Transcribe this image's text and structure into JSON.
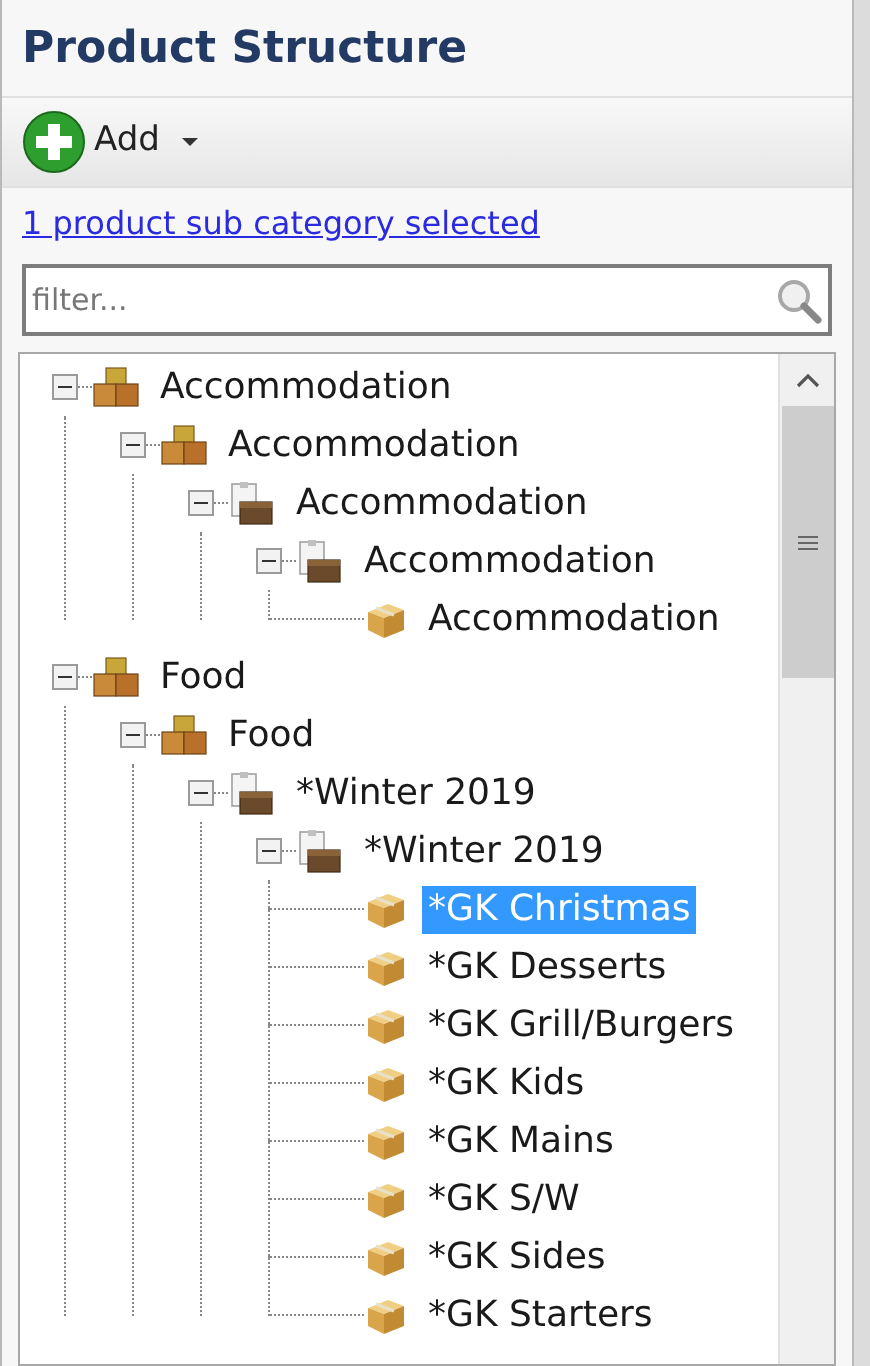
{
  "title": "Product Structure",
  "toolbar": {
    "add_label": "Add"
  },
  "selection_link": "1 product sub category selected",
  "filter": {
    "placeholder": "filter..."
  },
  "tree": [
    {
      "label": "Accommodation",
      "kind": "group",
      "expanded": true,
      "selected": false,
      "children": [
        {
          "label": "Accommodation",
          "kind": "group",
          "expanded": true,
          "selected": false,
          "children": [
            {
              "label": "Accommodation",
              "kind": "category",
              "expanded": true,
              "selected": false,
              "children": [
                {
                  "label": "Accommodation",
                  "kind": "category",
                  "expanded": true,
                  "selected": false,
                  "children": [
                    {
                      "label": "Accommodation",
                      "kind": "item",
                      "selected": false
                    }
                  ]
                }
              ]
            }
          ]
        }
      ]
    },
    {
      "label": "Food",
      "kind": "group",
      "expanded": true,
      "selected": false,
      "children": [
        {
          "label": "Food",
          "kind": "group",
          "expanded": true,
          "selected": false,
          "children": [
            {
              "label": "*Winter 2019",
              "kind": "category",
              "expanded": true,
              "selected": false,
              "children": [
                {
                  "label": "*Winter 2019",
                  "kind": "category",
                  "expanded": true,
                  "selected": false,
                  "children": [
                    {
                      "label": "*GK Christmas",
                      "kind": "item",
                      "selected": true
                    },
                    {
                      "label": "*GK Desserts",
                      "kind": "item",
                      "selected": false
                    },
                    {
                      "label": "*GK Grill/Burgers",
                      "kind": "item",
                      "selected": false
                    },
                    {
                      "label": "*GK Kids",
                      "kind": "item",
                      "selected": false
                    },
                    {
                      "label": "*GK Mains",
                      "kind": "item",
                      "selected": false
                    },
                    {
                      "label": "*GK S/W",
                      "kind": "item",
                      "selected": false
                    },
                    {
                      "label": "*GK Sides",
                      "kind": "item",
                      "selected": false
                    },
                    {
                      "label": "*GK Starters",
                      "kind": "item",
                      "selected": false
                    }
                  ]
                }
              ]
            }
          ]
        }
      ]
    }
  ]
}
